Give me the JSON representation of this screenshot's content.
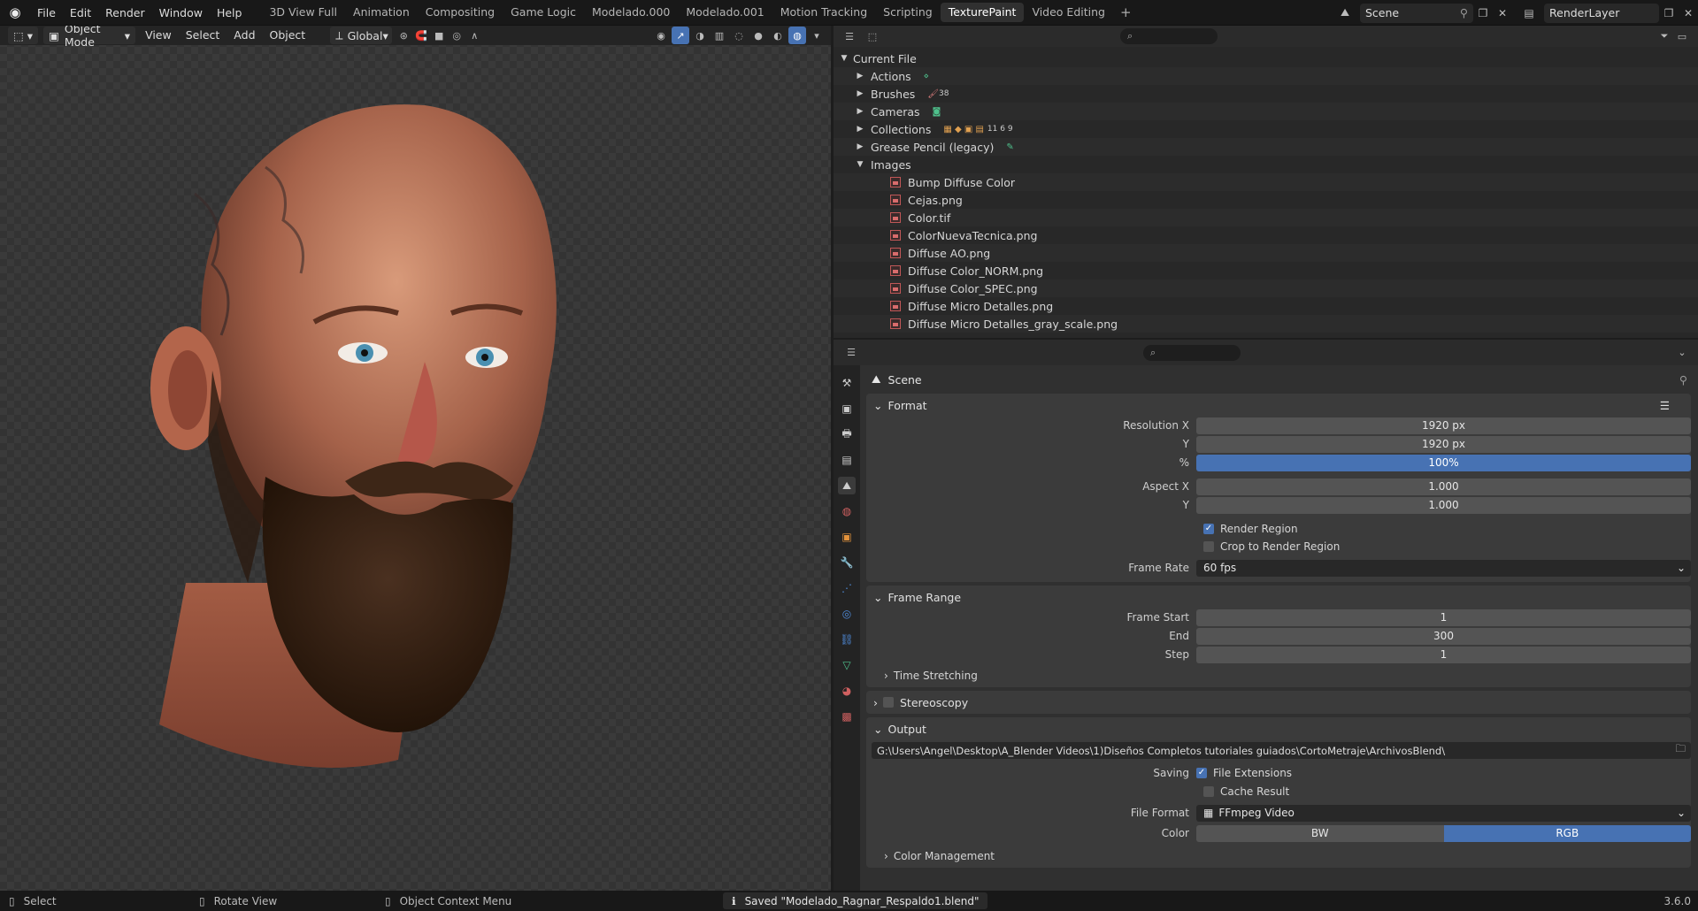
{
  "menu": [
    "File",
    "Edit",
    "Render",
    "Window",
    "Help"
  ],
  "workspaces": [
    "3D View Full",
    "Animation",
    "Compositing",
    "Game Logic",
    "Modelado.000",
    "Modelado.001",
    "Motion Tracking",
    "Scripting",
    "TexturePaint",
    "Video Editing"
  ],
  "active_workspace": "TexturePaint",
  "scene_name": "Scene",
  "view_layer": "RenderLayer",
  "viewport": {
    "mode": "Object Mode",
    "menus": [
      "View",
      "Select",
      "Add",
      "Object"
    ],
    "transform": "Global"
  },
  "outliner": {
    "root": "Current File",
    "categories": [
      {
        "label": "Actions",
        "badge": ""
      },
      {
        "label": "Brushes",
        "badge": "38"
      },
      {
        "label": "Cameras",
        "badge": ""
      },
      {
        "label": "Collections",
        "badge": "11  6  9"
      },
      {
        "label": "Grease Pencil (legacy)",
        "badge": ""
      },
      {
        "label": "Images",
        "badge": ""
      }
    ],
    "images": [
      "Bump Diffuse Color",
      "Cejas.png",
      "Color.tif",
      "ColorNuevaTecnica.png",
      "Diffuse AO.png",
      "Diffuse Color_NORM.png",
      "Diffuse Color_SPEC.png",
      "Diffuse Micro Detalles.png",
      "Diffuse Micro Detalles_gray_scale.png"
    ]
  },
  "properties": {
    "context": "Scene",
    "format": {
      "title": "Format",
      "res_x_label": "Resolution X",
      "res_x": "1920 px",
      "res_y_label": "Y",
      "res_y": "1920 px",
      "pct_label": "%",
      "pct": "100%",
      "aspect_x_label": "Aspect X",
      "aspect_x": "1.000",
      "aspect_y_label": "Y",
      "aspect_y": "1.000",
      "render_region": "Render Region",
      "crop_region": "Crop to Render Region",
      "frame_rate_label": "Frame Rate",
      "frame_rate": "60 fps"
    },
    "frame_range": {
      "title": "Frame Range",
      "start_label": "Frame Start",
      "start": "1",
      "end_label": "End",
      "end": "300",
      "step_label": "Step",
      "step": "1",
      "time_stretching": "Time Stretching"
    },
    "stereoscopy": "Stereoscopy",
    "output": {
      "title": "Output",
      "path": "G:\\Users\\Angel\\Desktop\\A_Blender Videos\\1)Diseños Completos tutoriales guiados\\CortoMetraje\\ArchivosBlend\\",
      "saving_label": "Saving",
      "file_extensions": "File Extensions",
      "cache_result": "Cache Result",
      "file_format_label": "File Format",
      "file_format": "FFmpeg Video",
      "color_label": "Color",
      "color_bw": "BW",
      "color_rgb": "RGB",
      "color_management": "Color Management"
    }
  },
  "status": {
    "select": "Select",
    "rotate": "Rotate View",
    "context_menu": "Object Context Menu",
    "message": "Saved \"Modelado_Ragnar_Respaldo1.blend\"",
    "version": "3.6.0"
  },
  "colors": {
    "accent": "#4772b3",
    "bg": "#303030",
    "header": "#181818"
  }
}
